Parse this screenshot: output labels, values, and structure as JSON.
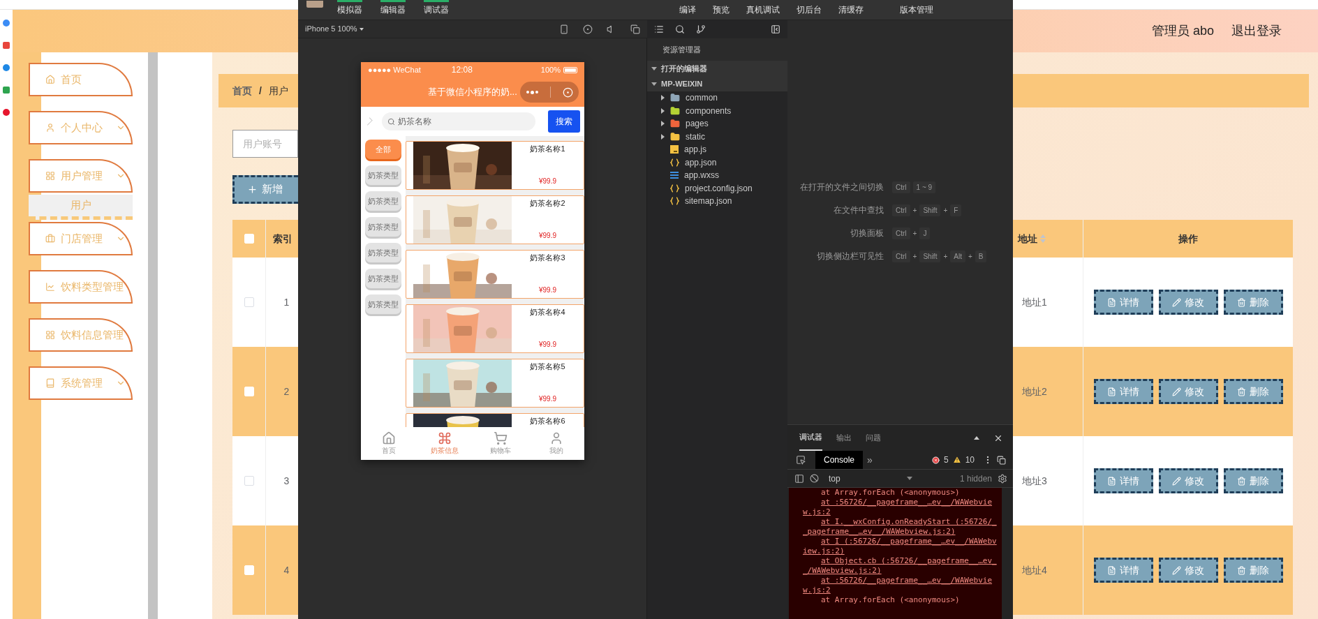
{
  "header": {
    "user": "管理员 abo",
    "logout": "退出登录"
  },
  "sidebar": {
    "items": [
      {
        "label": "首页",
        "kind": "link"
      },
      {
        "label": "个人中心",
        "kind": "group"
      },
      {
        "label": "用户管理",
        "kind": "group",
        "children": [
          {
            "label": "用户",
            "selected": true
          }
        ]
      },
      {
        "label": "门店管理",
        "kind": "group"
      },
      {
        "label": "饮料类型管理",
        "kind": "group"
      },
      {
        "label": "饮料信息管理",
        "kind": "group"
      },
      {
        "label": "系统管理",
        "kind": "group"
      }
    ]
  },
  "breadcrumb": [
    "首页",
    "用户"
  ],
  "breadcrumb_separator": "/",
  "search": {
    "placeholder": "用户账号"
  },
  "add_button": "新增",
  "table": {
    "all_checked": false,
    "columns": [
      {
        "label": "索引",
        "sortable": false
      },
      {
        "label": "地址",
        "sortable": true
      },
      {
        "label": "操作",
        "sortable": false
      }
    ],
    "rows": [
      {
        "checked": false,
        "index": "1",
        "address": "地址1",
        "actions": [
          {
            "kind": "detail",
            "label": "详情"
          },
          {
            "kind": "edit",
            "label": "修改"
          },
          {
            "kind": "delete",
            "label": "删除"
          }
        ]
      },
      {
        "checked": false,
        "index": "2",
        "address": "地址2",
        "actions": [
          {
            "kind": "detail",
            "label": "详情"
          },
          {
            "kind": "edit",
            "label": "修改"
          },
          {
            "kind": "delete",
            "label": "删除"
          }
        ]
      },
      {
        "checked": false,
        "index": "3",
        "address": "地址3",
        "actions": [
          {
            "kind": "detail",
            "label": "详情"
          },
          {
            "kind": "edit",
            "label": "修改"
          },
          {
            "kind": "delete",
            "label": "删除"
          }
        ]
      },
      {
        "checked": false,
        "index": "4",
        "address": "地址4",
        "actions": [
          {
            "kind": "detail",
            "label": "详情"
          },
          {
            "kind": "edit",
            "label": "修改"
          },
          {
            "kind": "delete",
            "label": "删除"
          }
        ]
      }
    ]
  },
  "devtools": {
    "toolbar_left": [
      "模拟器",
      "编辑器",
      "调试器"
    ],
    "toolbar_right": [
      "编译",
      "预览",
      "真机调试",
      "切后台",
      "清缓存",
      "版本管理"
    ],
    "device": "iPhone 5 100%",
    "phone": {
      "carrier": "●●●●● WeChat",
      "time": "12:08",
      "battery": "100%",
      "title": "基于微信小程序的奶...",
      "search_placeholder": "奶茶名称",
      "search_button": "搜索",
      "categories": [
        {
          "label": "全部",
          "selected": true
        },
        {
          "label": "奶茶类型",
          "selected": false
        },
        {
          "label": "奶茶类型",
          "selected": false
        },
        {
          "label": "奶茶类型",
          "selected": false
        },
        {
          "label": "奶茶类型",
          "selected": false
        },
        {
          "label": "奶茶类型",
          "selected": false
        },
        {
          "label": "奶茶类型",
          "selected": false
        }
      ],
      "products": [
        {
          "name": "奶茶名称1",
          "price": "¥99.9"
        },
        {
          "name": "奶茶名称2",
          "price": "¥99.9"
        },
        {
          "name": "奶茶名称3",
          "price": "¥99.9"
        },
        {
          "name": "奶茶名称4",
          "price": "¥99.9"
        },
        {
          "name": "奶茶名称5",
          "price": "¥99.9"
        },
        {
          "name": "奶茶名称6"
        }
      ],
      "tabs": [
        {
          "label": "首页",
          "selected": false
        },
        {
          "label": "奶茶信息",
          "selected": true
        },
        {
          "label": "购物车",
          "selected": false
        },
        {
          "label": "我的",
          "selected": false
        }
      ]
    },
    "explorer": {
      "title": "资源管理器",
      "sections": [
        {
          "label": "打开的编辑器",
          "expanded": true
        },
        {
          "label": "MP-WEIXIN",
          "expanded": true,
          "children": [
            {
              "label": "common",
              "kind": "folder",
              "color": "#8fa6b8",
              "expanded": false
            },
            {
              "label": "components",
              "kind": "folder",
              "color": "#b5d334",
              "expanded": false
            },
            {
              "label": "pages",
              "kind": "folder",
              "color": "#f0643c",
              "expanded": false
            },
            {
              "label": "static",
              "kind": "folder",
              "color": "#f5c242",
              "expanded": false
            },
            {
              "label": "app.js",
              "kind": "js"
            },
            {
              "label": "app.json",
              "kind": "json"
            },
            {
              "label": "app.wxss",
              "kind": "css"
            },
            {
              "label": "project.config.json",
              "kind": "json"
            },
            {
              "label": "sitemap.json",
              "kind": "json"
            }
          ]
        }
      ]
    },
    "shortcuts": [
      {
        "label": "在打开的文件之间切换",
        "keys": [
          {
            "kind": "key",
            "text": "Ctrl"
          },
          {
            "kind": "key",
            "text": "1 ~ 9"
          }
        ]
      },
      {
        "label": "在文件中查找",
        "keys": [
          {
            "kind": "key",
            "text": "Ctrl"
          },
          {
            "kind": "sep",
            "text": "+"
          },
          {
            "kind": "key",
            "text": "Shift"
          },
          {
            "kind": "sep",
            "text": "+"
          },
          {
            "kind": "key",
            "text": "F"
          }
        ]
      },
      {
        "label": "切换面板",
        "keys": [
          {
            "kind": "key",
            "text": "Ctrl"
          },
          {
            "kind": "sep",
            "text": "+"
          },
          {
            "kind": "key",
            "text": "J"
          }
        ]
      },
      {
        "label": "切换侧边栏可见性",
        "keys": [
          {
            "kind": "key",
            "text": "Ctrl"
          },
          {
            "kind": "sep",
            "text": "+"
          },
          {
            "kind": "key",
            "text": "Shift"
          },
          {
            "kind": "sep",
            "text": "+"
          },
          {
            "kind": "key",
            "text": "Alt"
          },
          {
            "kind": "sep",
            "text": "+"
          },
          {
            "kind": "key",
            "text": "B"
          }
        ]
      }
    ],
    "debugger": {
      "tabs": [
        {
          "label": "调试器",
          "selected": true
        },
        {
          "label": "输出",
          "selected": false
        },
        {
          "label": "问题",
          "selected": false
        }
      ],
      "console_tab": "Console",
      "more": "»",
      "errors": "5",
      "warnings": "10",
      "context": "top",
      "hidden": "1 hidden",
      "log": [
        {
          "kind": "plain",
          "text": "at Array.forEach (<anonymous>)"
        },
        {
          "kind": "link",
          "text": "at :56726/__pageframe__…ev__/WAWebview.js:2"
        },
        {
          "kind": "link",
          "text": "at I.__wxConfig.onReadyStart (:56726/__pageframe__…ev__/WAWebview.js:2)"
        },
        {
          "kind": "link",
          "text": "at I (:56726/__pageframe__…ev__/WAWebview.js:2)"
        },
        {
          "kind": "link",
          "text": "at Object.cb (:56726/__pageframe__…ev__/WAWebview.js:2)"
        },
        {
          "kind": "link",
          "text": "at :56726/__pageframe__…ev__/WAWebview.js:2"
        },
        {
          "kind": "plain",
          "text": "at Array.forEach (<anonymous>)"
        }
      ]
    }
  }
}
